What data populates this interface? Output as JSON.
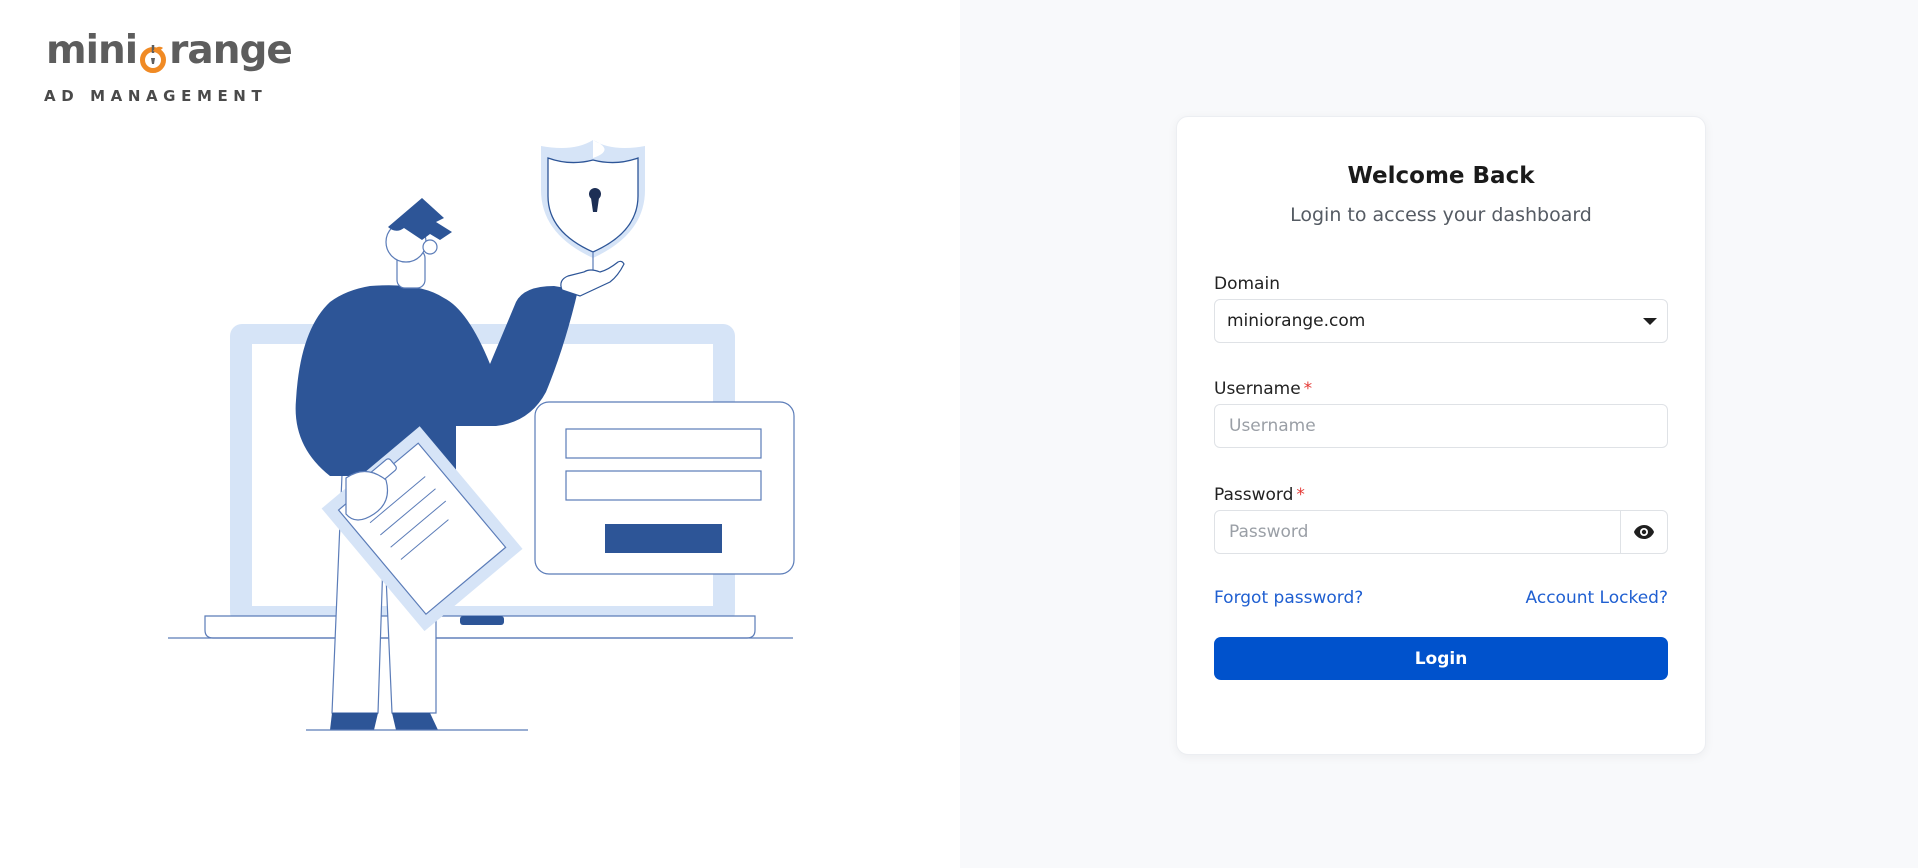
{
  "brand": {
    "logo_prefix": "mini",
    "logo_suffix": "range",
    "tagline": "AD MANAGEMENT",
    "accent_color": "#f08a24",
    "gray_color": "#5d5d5d"
  },
  "illustration": {
    "description_icon": "security-login-illustration-icon",
    "primary_color": "#2d5597",
    "light_color": "#d6e4f7"
  },
  "login_card": {
    "title": "Welcome Back",
    "subtitle": "Login to access your dashboard",
    "domain": {
      "label": "Domain",
      "selected": "miniorange.com"
    },
    "username": {
      "label": "Username",
      "required_mark": "*",
      "placeholder": "Username"
    },
    "password": {
      "label": "Password",
      "required_mark": "*",
      "placeholder": "Password",
      "toggle_icon": "eye-icon"
    },
    "forgot_password_link": "Forgot password?",
    "account_locked_link": "Account Locked?",
    "login_button": "Login",
    "button_color": "#0052cc",
    "link_color": "#1f5fd1"
  }
}
